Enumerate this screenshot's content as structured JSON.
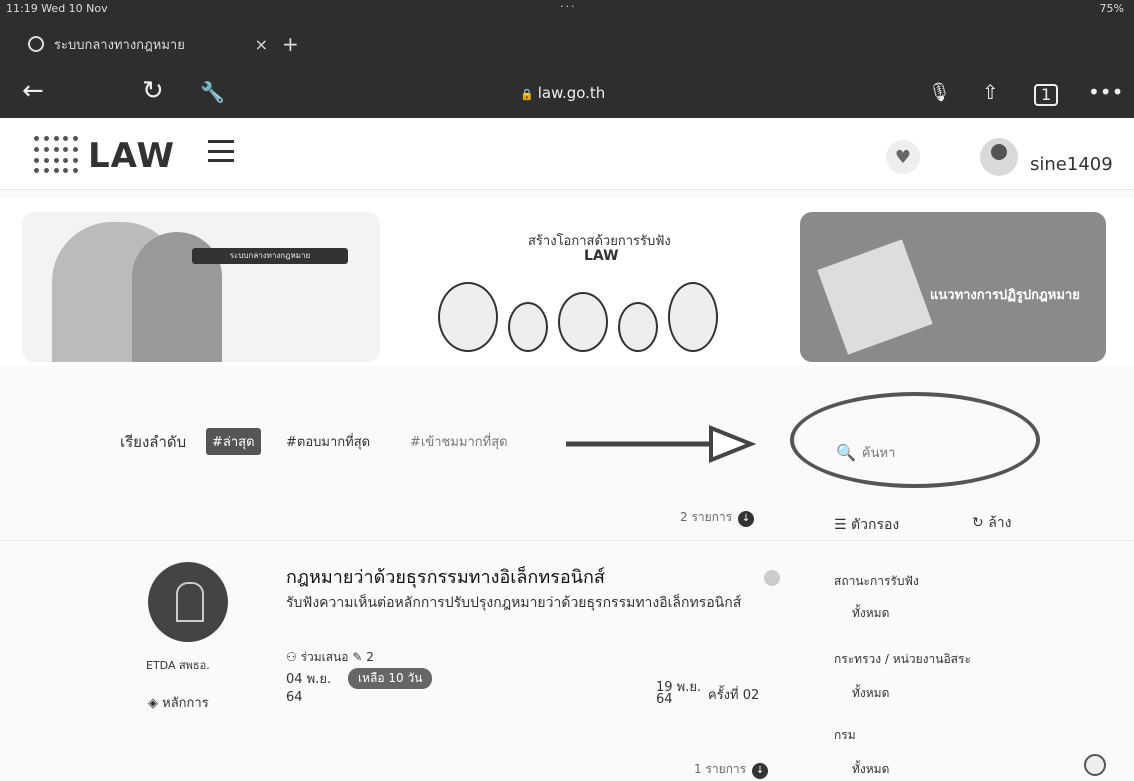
{
  "browser": {
    "status_time": "11:19 Wed 10 Nov",
    "battery": "75%",
    "tab_title": "ระบบกลางทางกฎหมาย",
    "tab_close": "×",
    "new_tab": "+",
    "url": "law.go.th"
  },
  "header": {
    "logo_text": "LAW",
    "username": "sine1409"
  },
  "banners": {
    "b1_tag": "ระบบกลางทางกฎหมาย",
    "b2_title": "สร้างโอกาสด้วยการรับฟัง",
    "b2_sub": "LAW",
    "b3_line2": "แนวทางการปฏิรูปกฎหมาย"
  },
  "sort": {
    "label": "เรียงลำดับ",
    "options": [
      "#ล่าสุด",
      "#ตอบมากที่สุด",
      "#เข้าชมมากที่สุด"
    ]
  },
  "search": {
    "placeholder": "ค้นหา"
  },
  "listing": {
    "count_top": "2 รายการ",
    "count_bottom": "1 รายการ",
    "filter_label": "ตัวกรอง",
    "clear_label": "ล้าง"
  },
  "card": {
    "title": "กฎหมายว่าด้วยธุรกรรมทางอิเล็กทรอนิกส์",
    "description": "รับฟังความเห็นต่อหลักการปรับปรุงกฎหมายว่าด้วยธุรกรรมทางอิเล็กทรอนิกส์",
    "org": "ETDA สพธอ.",
    "principles": "หลักการ",
    "participants_label": "ร่วมเสนอ",
    "participants_count": "2",
    "start_date_day": "04 พ.ย.",
    "start_date_year": "64",
    "remaining": "เหลือ 10 วัน",
    "end_date_day": "19 พ.ย.",
    "end_date_year": "64",
    "round": "ครั้งที่ 02"
  },
  "filters": {
    "status_label": "สถานะการรับฟัง",
    "status_value": "ทั้งหมด",
    "ministry_label": "กระทรวง / หน่วยงานอิสระ",
    "ministry_value": "ทั้งหมด",
    "dept_label": "กรม",
    "dept_value": "ทั้งหมด"
  }
}
